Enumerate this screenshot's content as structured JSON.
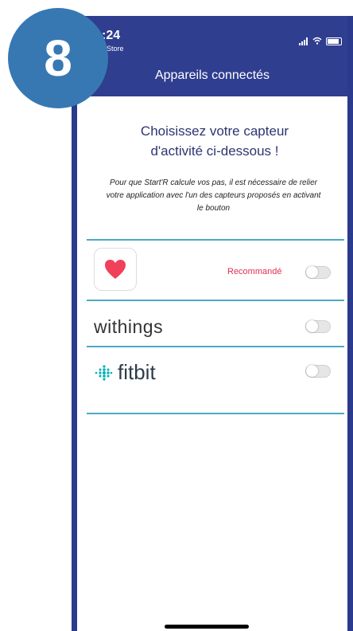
{
  "status_bar": {
    "time": ":24",
    "back_label": "Store"
  },
  "badge": {
    "number": "8"
  },
  "nav": {
    "title": "Appareils connectés"
  },
  "content": {
    "heading_line1": "Choisissez votre capteur",
    "heading_line2": "d'activité ci-dessous !",
    "desc_line1": "Pour que Start'R calcule vos pas, il est nécessaire de relier",
    "desc_line2": "votre application avec l'un des capteurs proposés en activant",
    "desc_line3": "le bouton"
  },
  "devices": [
    {
      "brand": "Apple Health",
      "icon": "heart-icon",
      "label": "Recommandé",
      "enabled": false
    },
    {
      "brand": "withings",
      "text": "withings",
      "enabled": false
    },
    {
      "brand": "fitbit",
      "text": "fitbit",
      "icon": "fitbit-dots-icon",
      "enabled": false
    }
  ],
  "colors": {
    "header": "#2f3e8f",
    "badge": "#3778b3",
    "divider": "#4ea8c6",
    "recommended": "#e03050"
  }
}
